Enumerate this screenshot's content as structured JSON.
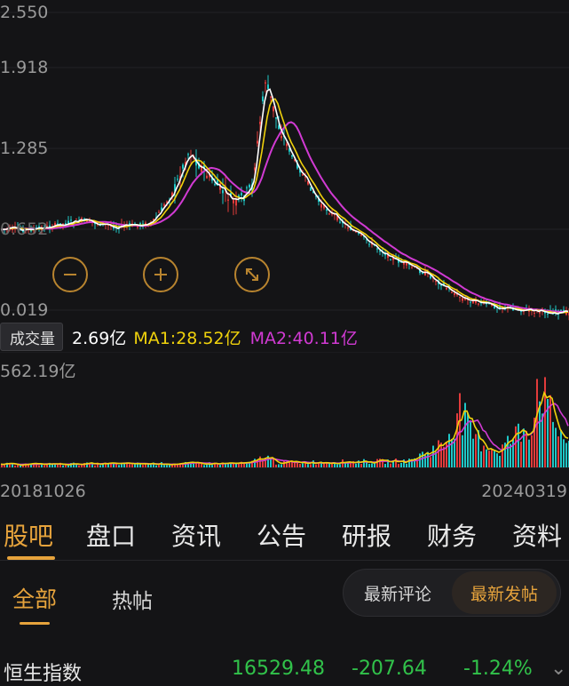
{
  "price_chart": {
    "y_labels": [
      "2.550",
      "1.918",
      "1.285",
      "0.652",
      "0.019"
    ],
    "ma_colors": {
      "ma5": "#ffffff",
      "ma10": "#f0d20c",
      "ma20": "#d13ad3"
    },
    "up_color": "#e23b3b",
    "down_color": "#1fc7c7"
  },
  "zoom_controls": {
    "zoom_out": "−",
    "zoom_in": "+",
    "fit": "⤡"
  },
  "volume": {
    "tag": "成交量",
    "current": "2.69亿",
    "ma1": "MA1:28.52亿",
    "ma2": "MA2:40.11亿",
    "max_label": "562.19亿"
  },
  "dates": {
    "start": "20181026",
    "end": "20240319"
  },
  "tabs": [
    "股吧",
    "盘口",
    "资讯",
    "公告",
    "研报",
    "财务",
    "资料"
  ],
  "active_tab": "股吧",
  "sub_tabs": {
    "all": "全部",
    "hot": "热帖"
  },
  "sort": {
    "left": "最新评论",
    "right": "最新发帖"
  },
  "ticker": {
    "name": "恒生指数",
    "price": "16529.48",
    "change": "-207.64",
    "pct": "-1.24%",
    "down_color": "#31c24a"
  }
}
